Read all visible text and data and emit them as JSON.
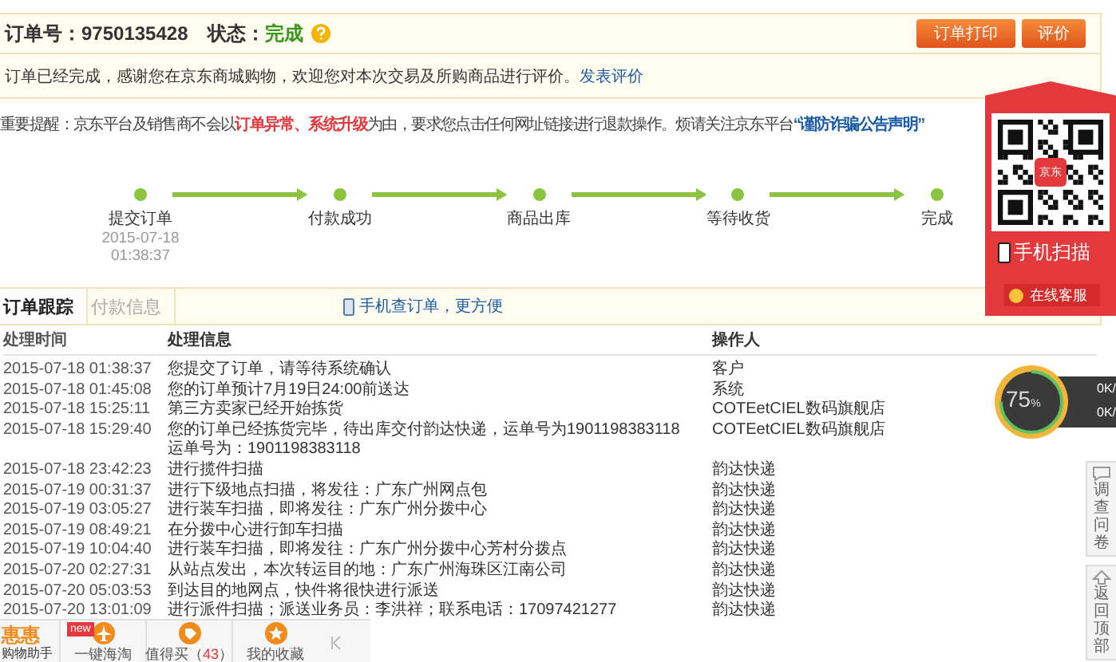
{
  "order": {
    "number_label": "订单号：",
    "number": "9750135428",
    "status_label": "状态：",
    "status": "完成"
  },
  "actions": [
    "订单打印",
    "评价"
  ],
  "notice": {
    "text": "订单已经完成，感谢您在京东商城购物，欢迎您对本次交易及所购商品进行评价。",
    "link": "发表评价"
  },
  "reminder": {
    "text": "重要提醒：京东平台及销售商不会以**订单异常、系统升级**为由，要求您点击任何网址链接进行退款操作。烦请关注京东平台",
    "link": "“谨防诈骗公告声明”"
  },
  "steps": [
    {
      "label": "提交订单",
      "date": "2015-07-18",
      "time": "01:38:37",
      "done": true
    },
    {
      "label": "付款成功",
      "done": true
    },
    {
      "label": "商品出库",
      "done": true
    },
    {
      "label": "等待收货",
      "done": true
    },
    {
      "label": "完成",
      "done": true
    }
  ],
  "tabs": [
    {
      "label": "订单跟踪",
      "selected": true
    },
    {
      "label": "付款信息",
      "selected": false
    }
  ],
  "mobile_link": "手机查订单，更方便",
  "table": {
    "columns": [
      "处理时间",
      "处理信息",
      "操作人"
    ],
    "rows": [
      {
        "time": "2015-07-18 01:38:37",
        "info": "您提交了订单，请等待系统确认",
        "operator": "客户"
      },
      {
        "time": "2015-07-18 01:45:08",
        "info": "您的订单预计7月19日24:00前送达",
        "operator": "系统"
      },
      {
        "time": "2015-07-18 15:25:11",
        "info": "第三方卖家已经开始拣货",
        "operator": "COTEetCIEL数码旗舰店"
      },
      {
        "time": "2015-07-18 15:29:40",
        "info": "您的订单已经拣货完毕，待出库交付韵达快递，运单号为1901198383118",
        "note": "运单号为：1901198383118",
        "operator": "COTEetCIEL数码旗舰店"
      },
      {
        "time": "2015-07-18 23:42:23",
        "info": "进行揽件扫描",
        "operator": "韵达快递"
      },
      {
        "time": "2015-07-19 00:31:37",
        "info": "进行下级地点扫描，将发往：广东广州网点包",
        "operator": "韵达快递"
      },
      {
        "time": "2015-07-19 03:05:27",
        "info": "进行装车扫描，即将发往：广东广州分拨中心",
        "operator": "韵达快递"
      },
      {
        "time": "2015-07-19 08:49:21",
        "info": "在分拨中心进行卸车扫描",
        "operator": "韵达快递"
      },
      {
        "time": "2015-07-19 10:04:40",
        "info": "进行装车扫描，即将发往：广东广州分拨中心芳村分拨点",
        "operator": "韵达快递"
      },
      {
        "time": "2015-07-20 02:27:31",
        "info": "从站点发出，本次转运目的地：广东广州海珠区江南公司",
        "operator": "韵达快递"
      },
      {
        "time": "2015-07-20 05:03:53",
        "info": "到达目的地网点，快件将很快进行派送",
        "operator": "韵达快递"
      },
      {
        "time": "2015-07-20 13:01:09",
        "info": "进行派件扫描；派送业务员：李洪祥；联系电话：17097421277",
        "operator": "韵达快递"
      }
    ]
  },
  "qr_banner": {
    "logo": "京东",
    "caption": "手机扫描"
  },
  "chat_button": "在线客服",
  "speed_widget": {
    "percent": "75",
    "unit": "%",
    "level": 0.75,
    "up": "0K/",
    "down": "0K/"
  },
  "side_tabs": [
    "调查问卷",
    "返回顶部"
  ],
  "toolbar": {
    "logo": "惠惠",
    "logo_sub": "购物助手",
    "badge": "new",
    "items": [
      {
        "label": "一键海淘",
        "kind": "plane"
      },
      {
        "label": "值得买（",
        "count": "43",
        "tail": "）",
        "kind": "tag"
      },
      {
        "label": "我的收藏",
        "kind": "star"
      }
    ]
  }
}
